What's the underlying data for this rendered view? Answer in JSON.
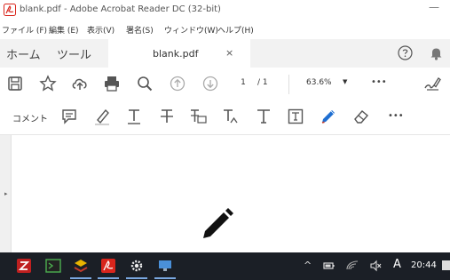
{
  "window": {
    "title": "blank.pdf - Adobe Acrobat Reader DC (32-bit)",
    "minimize_glyph": "—"
  },
  "menu": {
    "items": [
      "ファイル (F)",
      "編集 (E)",
      "表示(V)",
      "署名(S)",
      "ウィンドウ(W)",
      "ヘルプ(H)"
    ]
  },
  "tabs": {
    "home": "ホーム",
    "tools": "ツール",
    "document": "blank.pdf",
    "close": "×"
  },
  "toolbar": {
    "page_current": "1",
    "page_total": "/ 1",
    "zoom": "63.6%",
    "more": "•••"
  },
  "comment_toolbar": {
    "label": "コメント",
    "more": "•••",
    "pen_color": "#1f6fd1"
  },
  "taskbar": {
    "clock": "20:44",
    "ime": "A",
    "caret": "^",
    "apps": [
      "filezilla-icon",
      "terminal-icon",
      "scroller-icon",
      "acrobat-icon",
      "gear-icon",
      "remote-desktop-icon"
    ]
  },
  "icons": {
    "toolbar": [
      "save-icon",
      "bookmark-star-icon",
      "cloud-upload-icon",
      "print-icon",
      "zoom-icon",
      "page-up-icon",
      "page-down-icon",
      "sign-icon"
    ],
    "annotation": [
      "sticky-note-icon",
      "highlighter-icon",
      "underline-icon",
      "strikethrough-icon",
      "replace-text-icon",
      "insert-text-icon",
      "add-text-icon",
      "text-box-icon",
      "pencil-icon",
      "eraser-icon"
    ],
    "canvas": "pencil-cursor-icon"
  },
  "colors": {
    "acrobat_red": "#d9251c",
    "pencil_blue": "#1f6fd1",
    "taskbar_bg": "#1b1f26"
  }
}
